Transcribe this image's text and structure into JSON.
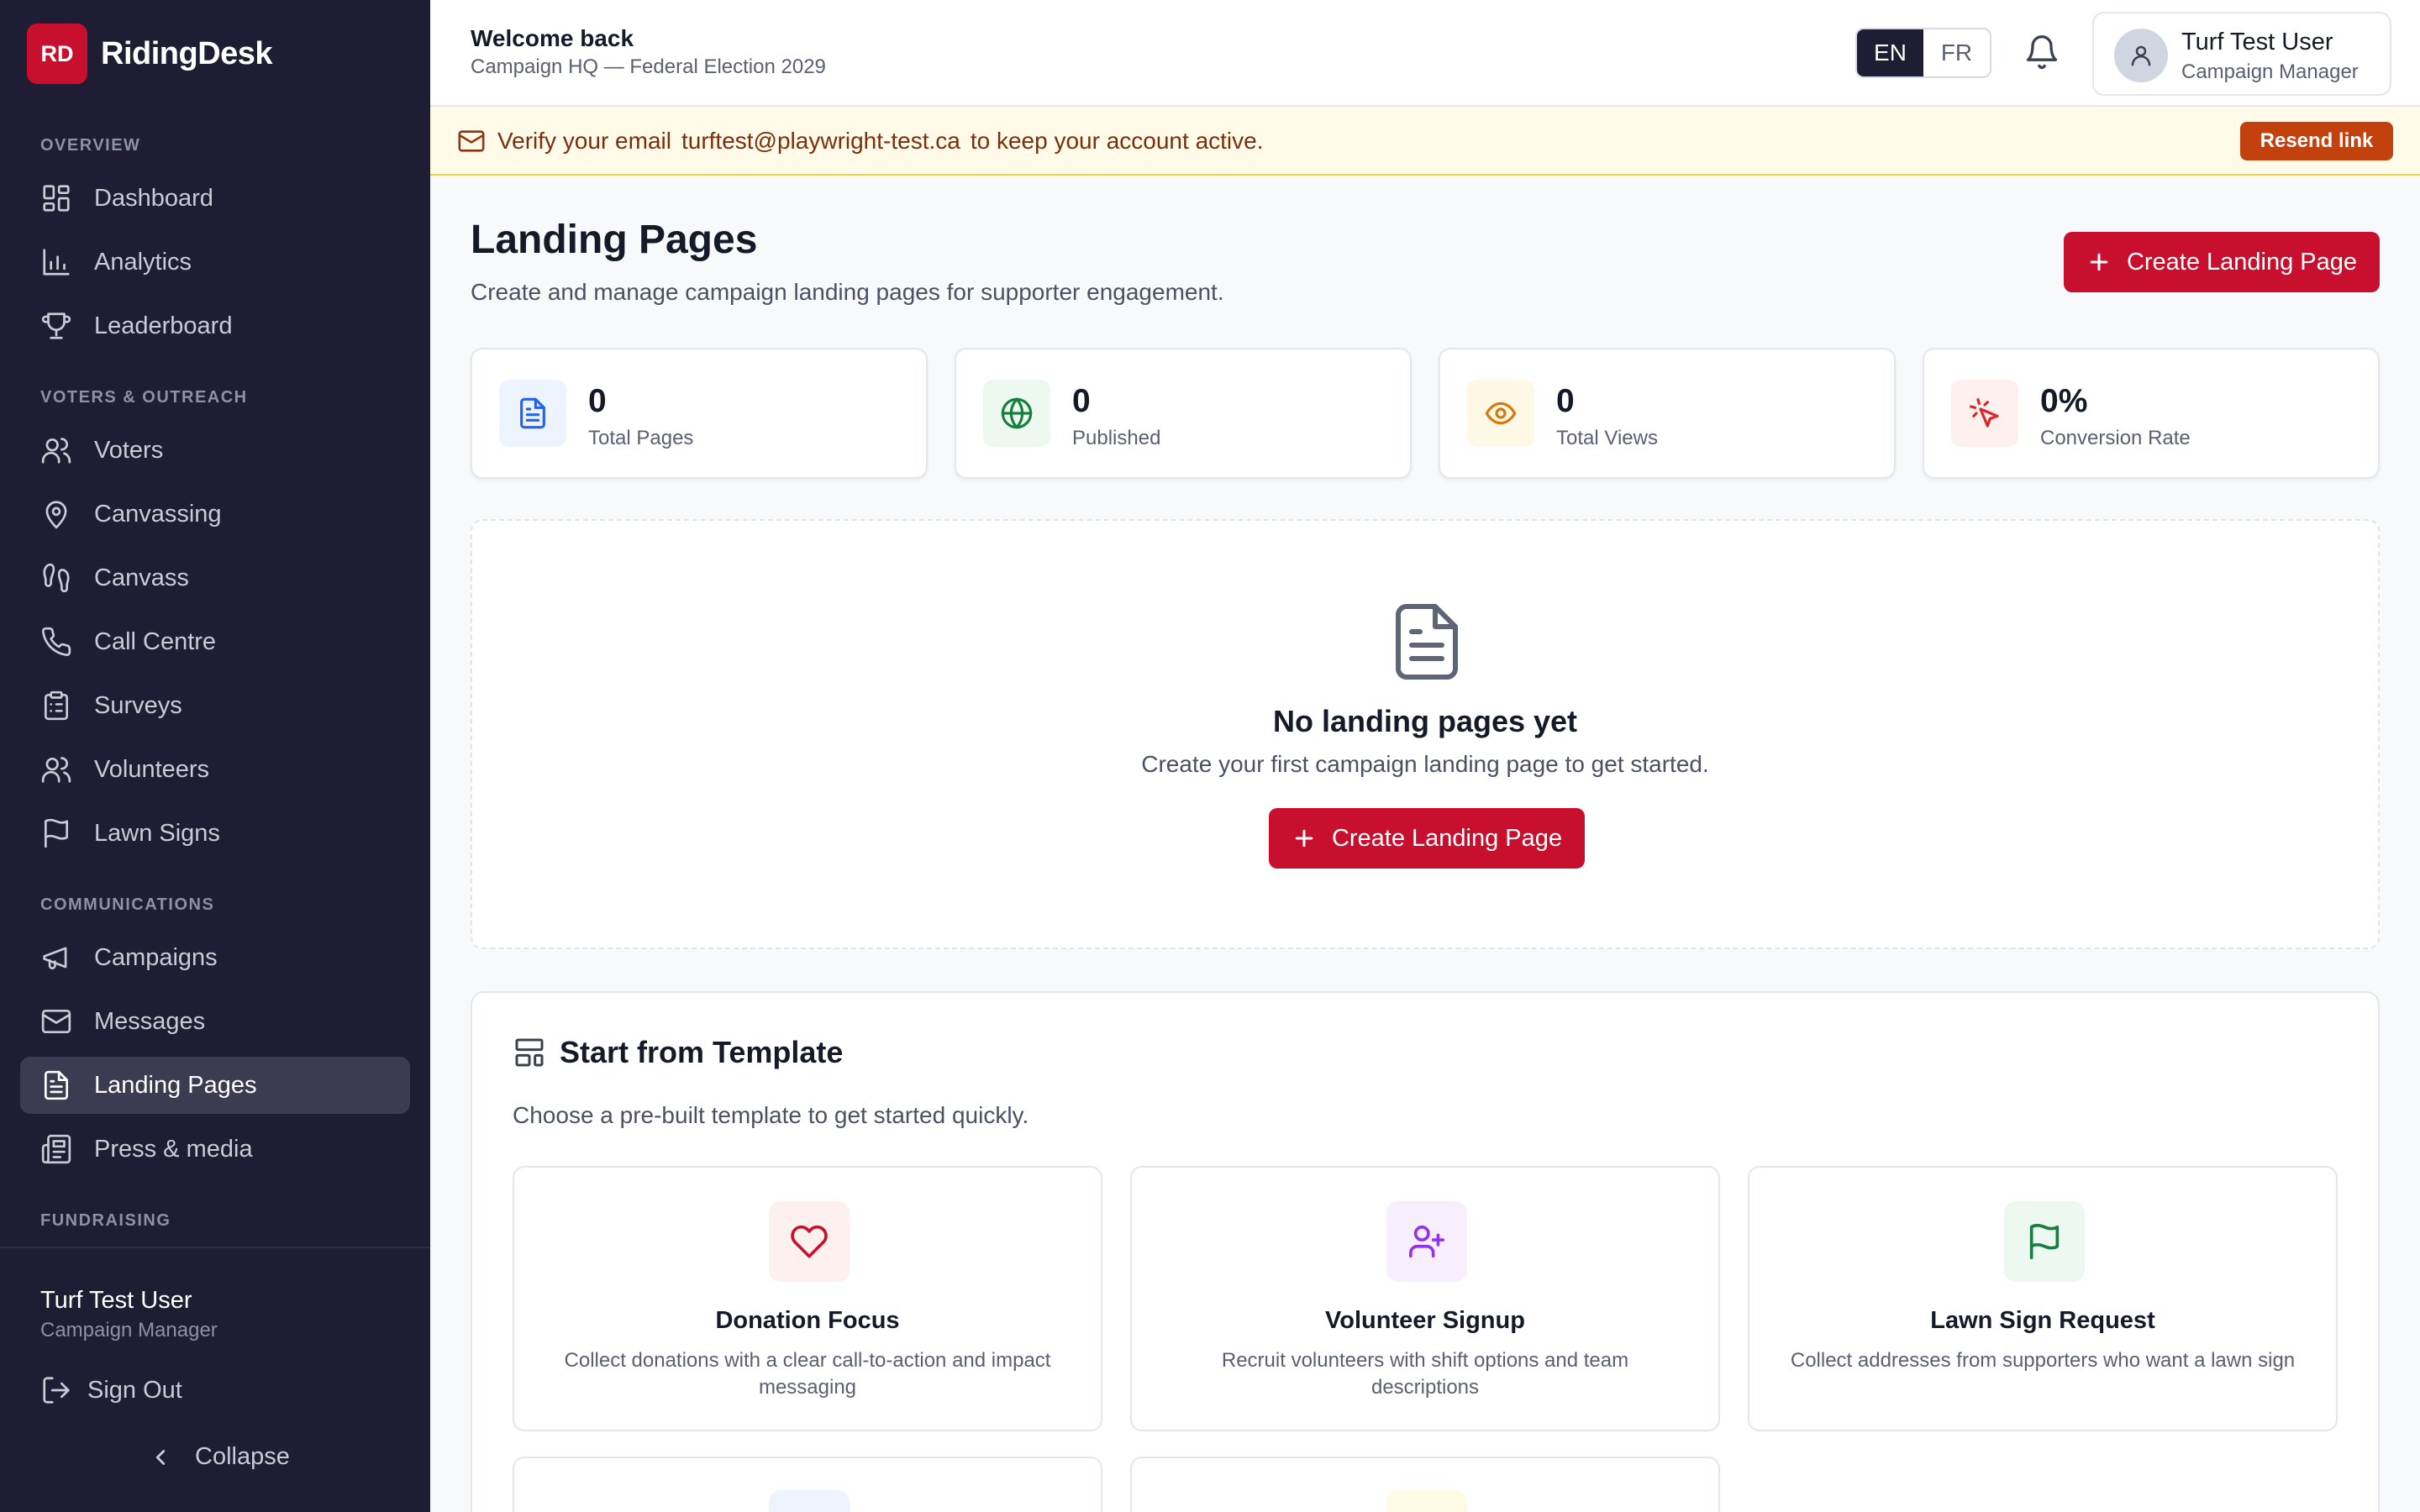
{
  "brand": {
    "logo": "RD",
    "name": "RidingDesk",
    "color": "#c8102e"
  },
  "sidebar": {
    "sections": {
      "overview": "OVERVIEW",
      "voters": "VOTERS & OUTREACH",
      "comms": "COMMUNICATIONS",
      "fundraising": "FUNDRAISING"
    },
    "items": [
      {
        "label": "Dashboard",
        "icon": "dashboard-icon"
      },
      {
        "label": "Analytics",
        "icon": "bar-chart-icon"
      },
      {
        "label": "Leaderboard",
        "icon": "trophy-icon"
      },
      {
        "label": "Voters",
        "icon": "users-icon"
      },
      {
        "label": "Canvassing",
        "icon": "map-pin-icon"
      },
      {
        "label": "Canvass",
        "icon": "footprints-icon"
      },
      {
        "label": "Call Centre",
        "icon": "phone-icon"
      },
      {
        "label": "Surveys",
        "icon": "clipboard-icon"
      },
      {
        "label": "Volunteers",
        "icon": "users-icon"
      },
      {
        "label": "Lawn Signs",
        "icon": "flag-icon"
      },
      {
        "label": "Campaigns",
        "icon": "megaphone-icon"
      },
      {
        "label": "Messages",
        "icon": "mail-icon"
      },
      {
        "label": "Landing Pages",
        "icon": "file-text-icon",
        "active": true
      },
      {
        "label": "Press & media",
        "icon": "newspaper-icon"
      }
    ],
    "user": {
      "name": "Turf Test User",
      "role": "Campaign Manager"
    },
    "sign_out": "Sign Out",
    "collapse": "Collapse"
  },
  "header": {
    "title": "Welcome back",
    "subtitle": "Campaign HQ — Federal Election 2029",
    "lang": {
      "en": "EN",
      "fr": "FR",
      "selected": "EN"
    },
    "user": {
      "name": "Turf Test User",
      "role": "Campaign Manager"
    }
  },
  "banner": {
    "prefix": "Verify your email",
    "email": "turftest@playwright-test.ca",
    "suffix": "to keep your account active.",
    "button": "Resend link"
  },
  "page": {
    "title": "Landing Pages",
    "description": "Create and manage campaign landing pages for supporter engagement.",
    "create_label": "Create Landing Page"
  },
  "stats": [
    {
      "value": "0",
      "label": "Total Pages",
      "icon": "file-text-icon",
      "color": "#2563eb",
      "bg": "#eef4ff"
    },
    {
      "value": "0",
      "label": "Published",
      "icon": "globe-icon",
      "color": "#15803d",
      "bg": "#ecf8f0"
    },
    {
      "value": "0",
      "label": "Total Views",
      "icon": "eye-icon",
      "color": "#d97706",
      "bg": "#fff8e6"
    },
    {
      "value": "0%",
      "label": "Conversion Rate",
      "icon": "cursor-click-icon",
      "color": "#dc2626",
      "bg": "#fff0f0"
    }
  ],
  "empty": {
    "title": "No landing pages yet",
    "description": "Create your first campaign landing page to get started.",
    "button": "Create Landing Page"
  },
  "templates": {
    "title": "Start from Template",
    "description": "Choose a pre-built template to get started quickly.",
    "items": [
      {
        "name": "Donation Focus",
        "description": "Collect donations with a clear call-to-action and impact messaging",
        "icon": "heart-icon",
        "color": "#c8102e",
        "bg": "#fff0f0"
      },
      {
        "name": "Volunteer Signup",
        "description": "Recruit volunteers with shift options and team descriptions",
        "icon": "user-plus-icon",
        "color": "#9333ea",
        "bg": "#f7effd"
      },
      {
        "name": "Lawn Sign Request",
        "description": "Collect addresses from supporters who want a lawn sign",
        "icon": "flag-icon",
        "color": "#15803d",
        "bg": "#ecf8f0"
      }
    ]
  }
}
